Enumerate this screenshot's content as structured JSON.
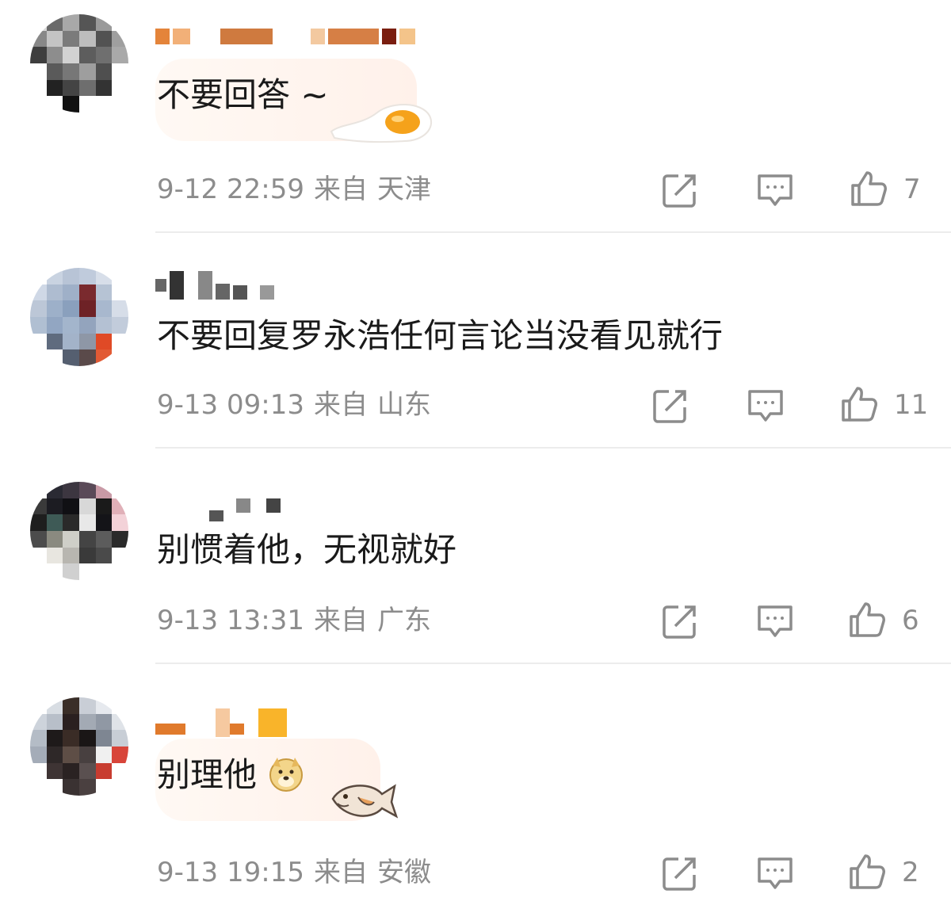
{
  "comments": [
    {
      "text": "不要回答 ~",
      "time": "9-12 22:59",
      "from": "来自",
      "location": "天津",
      "likes": "7"
    },
    {
      "text": "不要回复罗永浩任何言论当没看见就行",
      "time": "9-13 09:13",
      "from": "来自",
      "location": "山东",
      "likes": "11"
    },
    {
      "text": "别惯着他，无视就好",
      "time": "9-13 13:31",
      "from": "来自",
      "location": "广东",
      "likes": "6"
    },
    {
      "text": "别理他",
      "time": "9-13 19:15",
      "from": "来自",
      "location": "安徽",
      "likes": "2"
    }
  ],
  "icons": {
    "share": "share-icon",
    "reply": "comment-icon",
    "like": "thumbs-up-icon",
    "doge": "doge-emoji-icon",
    "egg": "fried-egg-sticker-icon",
    "fish": "fish-sticker-icon"
  },
  "colors": {
    "text": "#1a1a1a",
    "meta": "#8c8c8c",
    "divider": "#ececec",
    "icon": "#8c8c8c"
  }
}
